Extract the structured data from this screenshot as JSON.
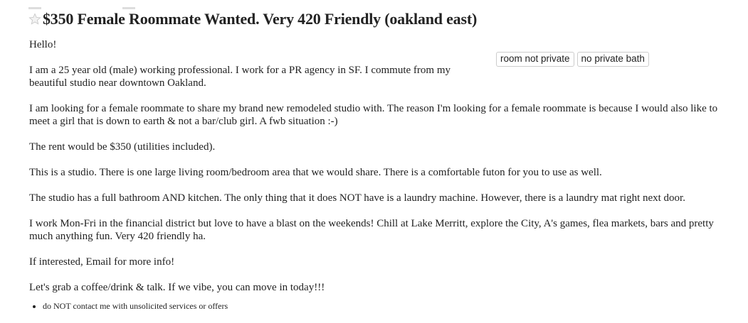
{
  "posting": {
    "title": "$350 Female Roommate Wanted. Very 420 Friendly (oakland east)",
    "attributes": [
      "room not private",
      "no private bath"
    ],
    "body": [
      "Hello!",
      "I am a 25 year old (male) working professional. I work for a PR agency in SF. I commute from my beautiful studio near downtown Oakland.",
      "I am looking for a female roommate to share my brand new remodeled studio with. The reason I'm looking for a female roommate is because I would also like to meet a girl that is down to earth & not a bar/club girl. A fwb situation :-)",
      "The rent would be $350 (utilities included).",
      "This is a studio. There is one large living room/bedroom area that we would share. There is a comfortable futon for you to use as well.",
      "The studio has a full bathroom AND kitchen. The only thing that it does NOT have is a laundry machine. However, there is a laundry mat right next door.",
      "I work Mon-Fri in the financial district but love to have a blast on the weekends! Chill at Lake Merritt, explore the City, A's games, flea markets, bars and pretty much anything fun. Very 420 friendly ha.",
      "If interested, Email for more info!",
      "Let's grab a coffee/drink & talk. If we vibe, you can move in today!!!"
    ],
    "notices": [
      "do NOT contact me with unsolicited services or offers"
    ]
  },
  "icons": {
    "favorite": "star-outline-icon"
  }
}
